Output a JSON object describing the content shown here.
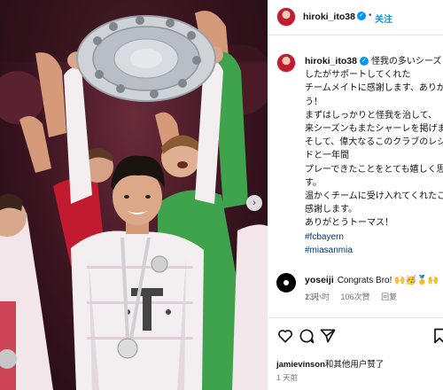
{
  "post": {
    "username": "hiroki_ito38",
    "header_separator": "•",
    "follow_label": "关注"
  },
  "caption": {
    "username": "hiroki_ito38",
    "lines": [
      "怪我の多いシーズンで",
      "したがサポートしてくれた",
      "チームメイトに感謝します、ありがと",
      "う！",
      "まずはしっかりと怪我を治して、",
      "来シーズンもまたシャーレを掲げます!",
      "そして、偉大なるこのクラブのレジェン",
      "ドと一年間",
      "プレーできたことをとても嬉しく思いま",
      "す。",
      "温かくチームに受け入れてくれたことに",
      "感謝します。",
      "ありがとうトーマス！"
    ],
    "hashtags": [
      "#fcbayern",
      "#miasanmia"
    ],
    "time": "1 天"
  },
  "comment": {
    "username": "yoseiji",
    "text": "Congrats Bro! 🙌🥳🥇🙌",
    "time": "23小时",
    "likes": "106次赞",
    "reply_label": "回复"
  },
  "actions": {
    "icons": [
      "heart-icon",
      "comment-icon",
      "share-icon",
      "bookmark-icon"
    ]
  },
  "likes_line": {
    "username": "jamievinson",
    "suffix": "和其他用户赞了"
  },
  "post_time": "1 天前",
  "colors": {
    "accent": "#0095f6",
    "hashtag": "#00376b",
    "muted": "#737373",
    "jersey_red": "#c21b2f"
  }
}
